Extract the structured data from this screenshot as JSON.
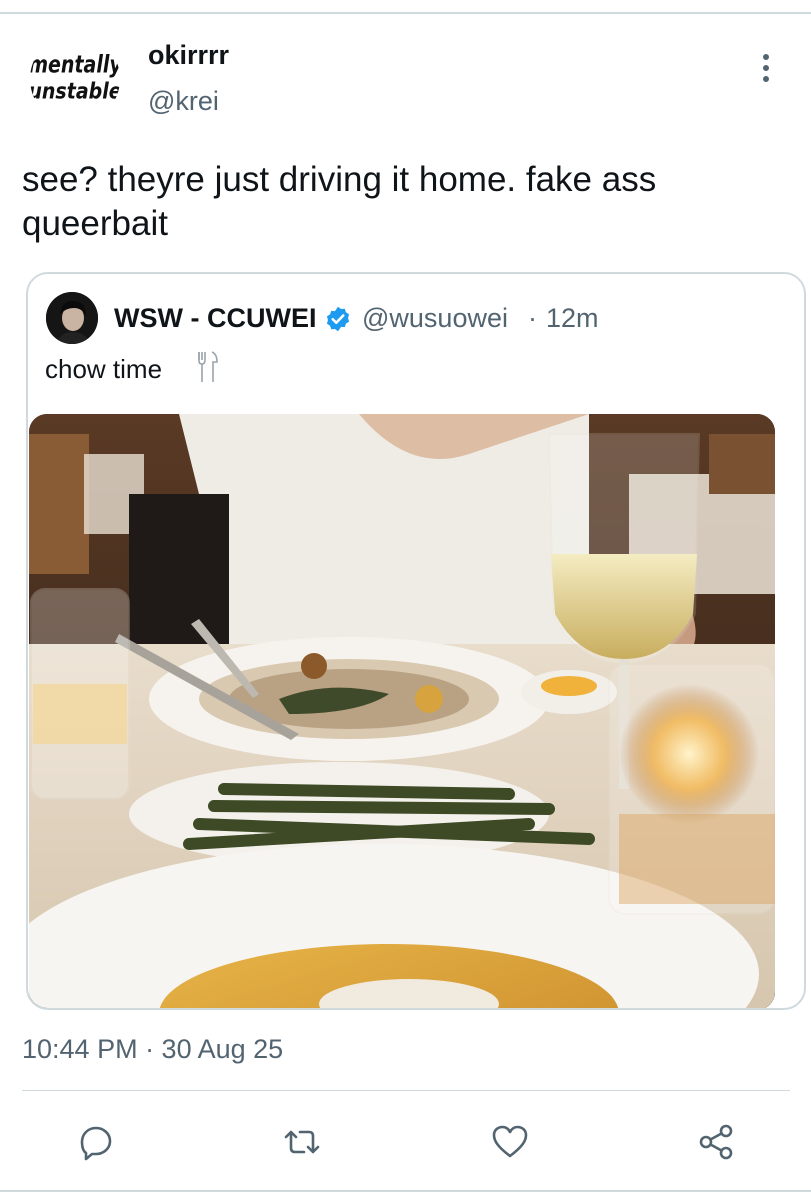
{
  "post": {
    "author_name": "okirrrr",
    "author_handle": "@krei",
    "avatar_text_top": "mentally",
    "avatar_text_bottom": "unstable",
    "text_line1": "see? theyre just driving it home. fake ass",
    "text_line2": "queerbait",
    "timestamp": "10:44 PM · 30 Aug 25"
  },
  "quote": {
    "author_name": "WSW - CCUWEI",
    "author_handle": "@wusuowei",
    "separator": "·",
    "time_ago": "12m",
    "text": "chow time",
    "verified_color": "#1d9bf0"
  },
  "actions": {
    "reply_icon": "reply-icon",
    "retweet_icon": "retweet-icon",
    "like_icon": "heart-icon",
    "share_icon": "share-icon"
  },
  "colors": {
    "text_primary": "#0f1419",
    "text_secondary": "#536471",
    "border": "#cfd9de",
    "icon": "#536471"
  }
}
